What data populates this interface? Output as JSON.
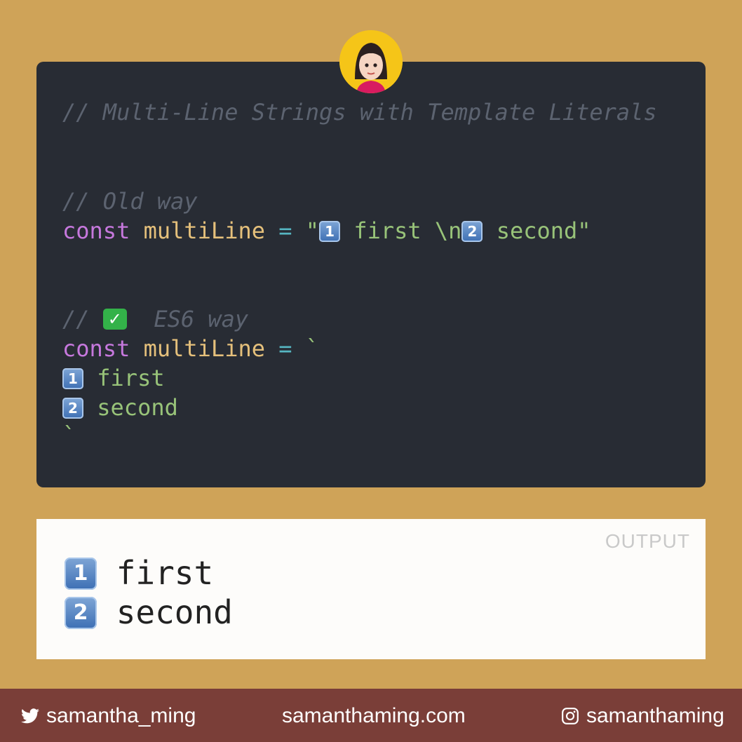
{
  "code": {
    "title_comment": "// Multi-Line Strings with Template Literals",
    "old_comment": "// Old way",
    "old_kw": "const",
    "old_var": "multiLine",
    "old_eq": "=",
    "old_str_open": "\"",
    "old_key1": "1",
    "old_str_mid": " first \\n",
    "old_key2": "2",
    "old_str_end": " second\"",
    "es6_comment_prefix": "// ",
    "es6_check": "✓",
    "es6_comment_suffix": "  ES6 way",
    "es6_kw": "const",
    "es6_var": "multiLine",
    "es6_eq": "=",
    "es6_tick_open": "`",
    "es6_key1": "1",
    "es6_line1": " first",
    "es6_key2": "2",
    "es6_line2": " second",
    "es6_tick_close": "`"
  },
  "output": {
    "label": "OUTPUT",
    "key1": "1",
    "line1": " first",
    "key2": "2",
    "line2": " second"
  },
  "footer": {
    "twitter": "samantha_ming",
    "website": "samanthaming.com",
    "instagram": "samanthaming"
  },
  "colors": {
    "background": "#cfa358",
    "code_bg": "#282c34",
    "footer_bg": "#7a3e38"
  }
}
